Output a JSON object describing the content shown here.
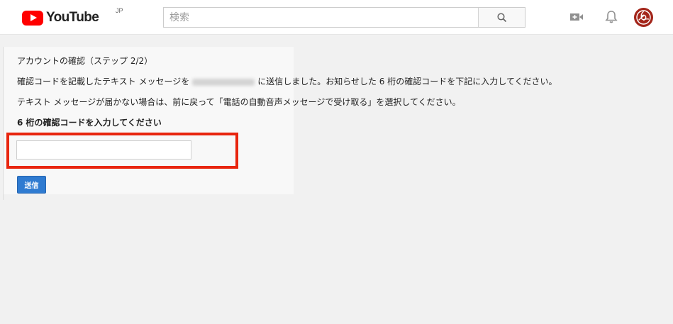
{
  "header": {
    "logo_text": "YouTube",
    "logo_region": "JP",
    "search_placeholder": "検索",
    "icons": [
      "upload-video-icon",
      "notification-bell-icon",
      "account-avatar-icon",
      "search-icon"
    ]
  },
  "content": {
    "heading": "アカウントの確認（ステップ 2/2）",
    "message1_before": "確認コードを記載したテキスト メッセージを",
    "message1_after": "に送信しました。お知らせした 6 桁の確認コードを下記に入力してください。",
    "message2": "テキスト メッセージが届かない場合は、前に戻って「電話の自動音声メッセージで受け取る」を選択してください。",
    "code_label": "6 桁の確認コードを入力してください",
    "code_value": "",
    "submit_label": "送信"
  },
  "colors": {
    "youtube_red": "#ff0000",
    "highlight_red": "#e8250e",
    "button_blue": "#2f7bd1",
    "avatar_red": "#a3251a"
  }
}
